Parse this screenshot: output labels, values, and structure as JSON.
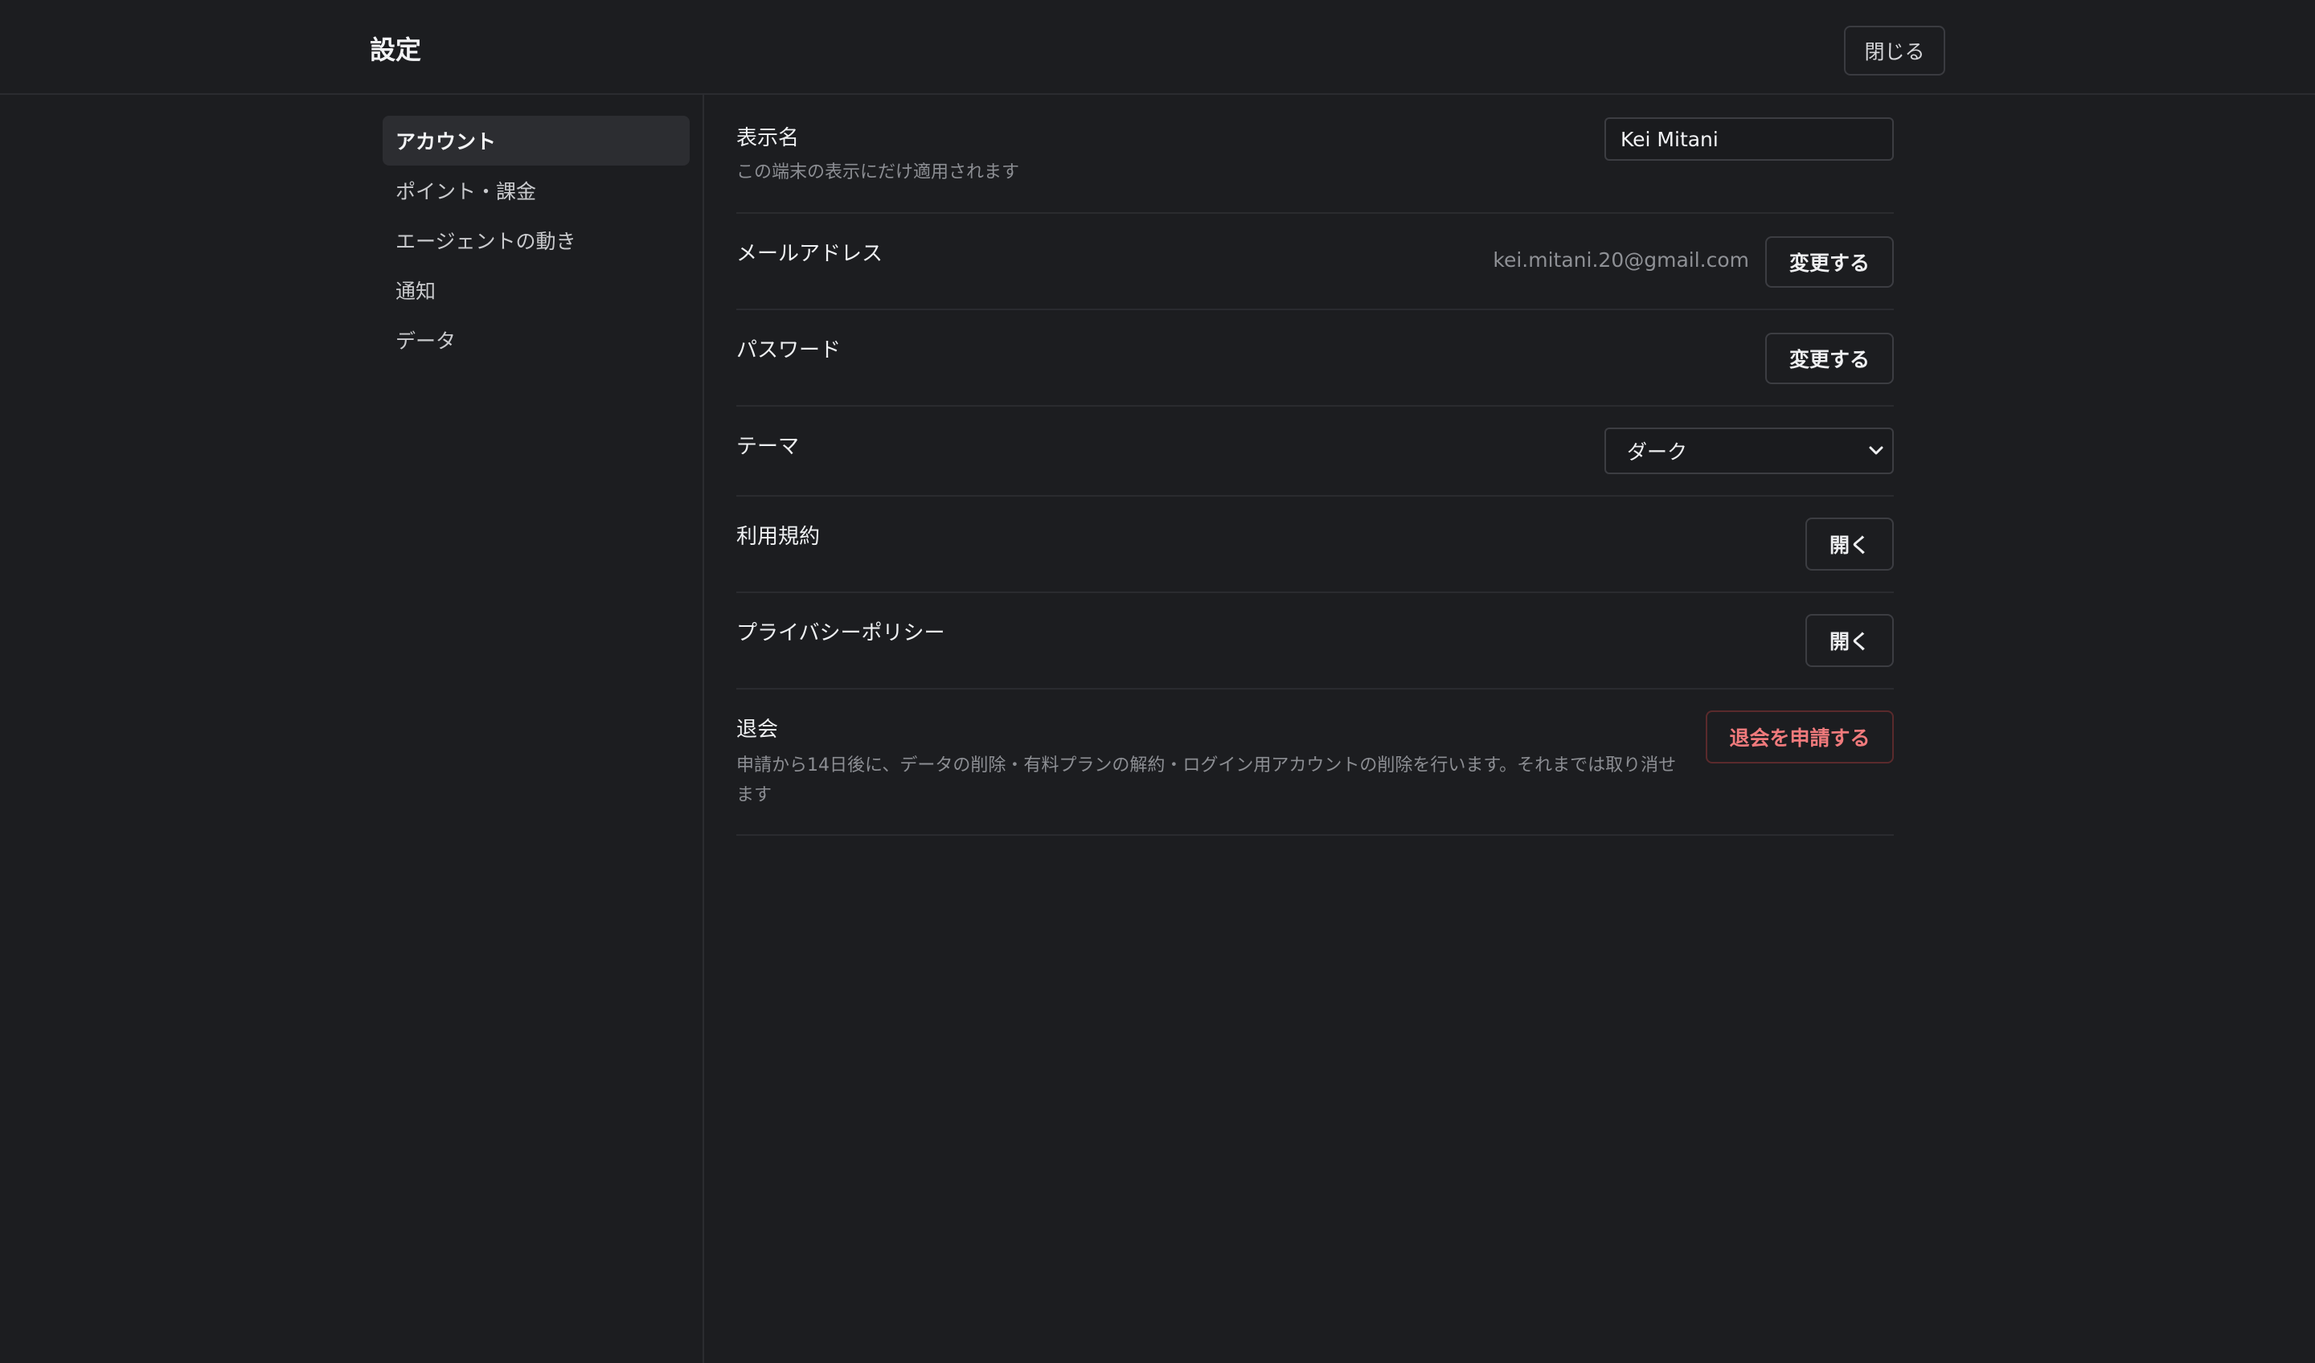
{
  "header": {
    "title": "設定",
    "close_label": "閉じる"
  },
  "sidebar": {
    "items": [
      {
        "label": "アカウント",
        "active": true
      },
      {
        "label": "ポイント・課金",
        "active": false
      },
      {
        "label": "エージェントの動き",
        "active": false
      },
      {
        "label": "通知",
        "active": false
      },
      {
        "label": "データ",
        "active": false
      }
    ]
  },
  "settings": {
    "display_name": {
      "label": "表示名",
      "description": "この端末の表示にだけ適用されます",
      "value": "Kei Mitani"
    },
    "email": {
      "label": "メールアドレス",
      "value": "kei.mitani.20@gmail.com",
      "button": "変更する"
    },
    "password": {
      "label": "パスワード",
      "button": "変更する"
    },
    "theme": {
      "label": "テーマ",
      "selected": "ダーク"
    },
    "terms": {
      "label": "利用規約",
      "button": "開く"
    },
    "privacy": {
      "label": "プライバシーポリシー",
      "button": "開く"
    },
    "withdraw": {
      "label": "退会",
      "description": "申請から14日後に、データの削除・有料プランの解約・ログイン用アカウントの削除を行います。それまでは取り消せます",
      "button": "退会を申請する"
    }
  },
  "colors": {
    "background": "#1c1d20",
    "danger": "#f07a7c",
    "active_nav": "#2c2d31"
  },
  "icons": {
    "theme_select": "chevron-down-icon"
  }
}
